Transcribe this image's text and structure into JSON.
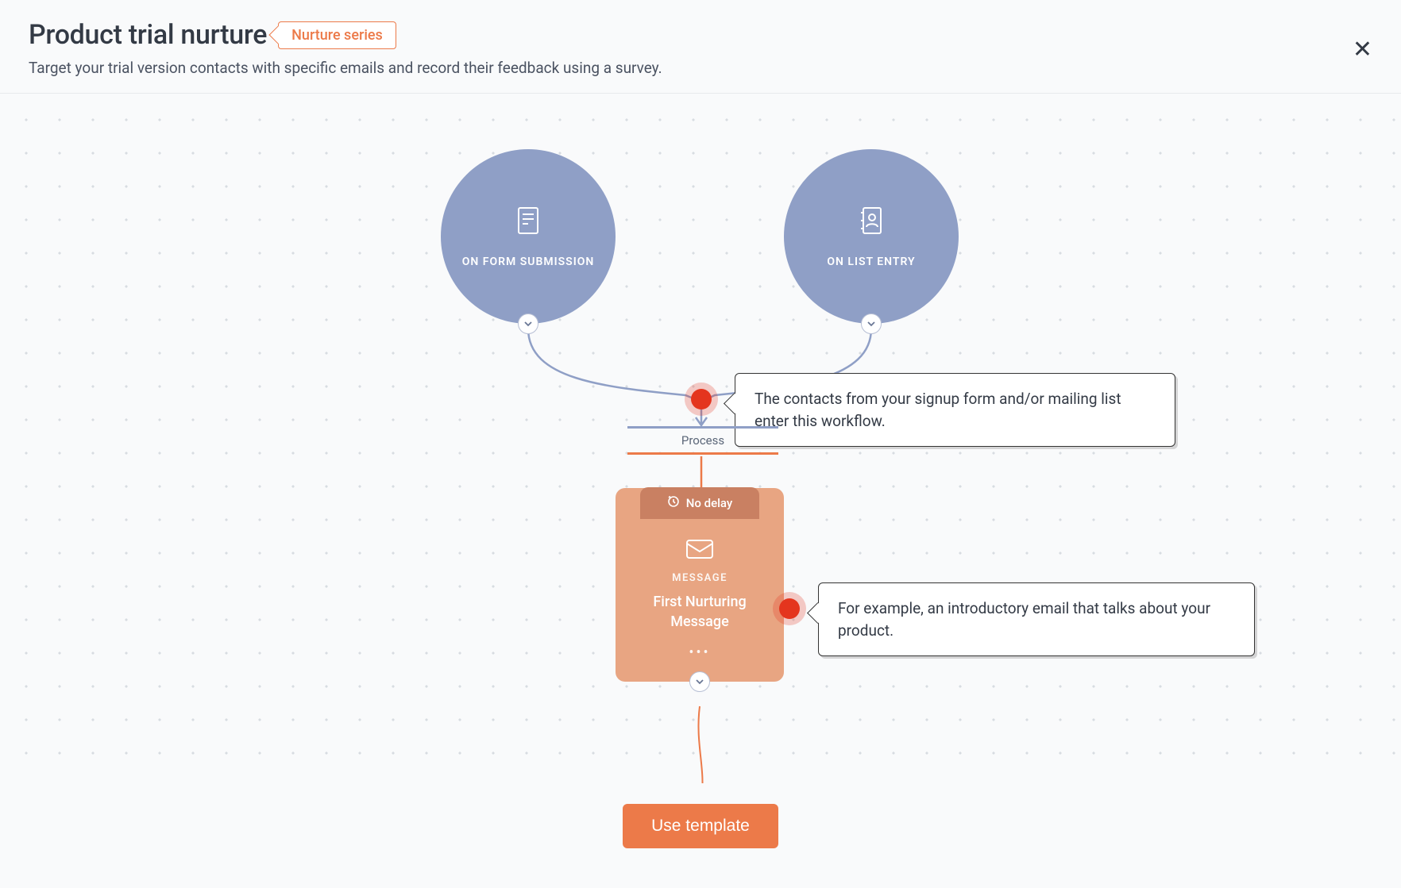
{
  "header": {
    "title": "Product trial nurture",
    "tag": "Nurture series",
    "subtitle": "Target your trial version contacts with specific emails and record their feedback using a survey."
  },
  "triggers": {
    "form": {
      "label": "ON FORM SUBMISSION"
    },
    "list": {
      "label": "ON LIST ENTRY"
    }
  },
  "process_label": "Process",
  "message": {
    "delay": "No delay",
    "type": "MESSAGE",
    "name": "First Nurturing Message"
  },
  "callouts": {
    "entry": "The contacts from your signup form and/or mailing list enter this workflow.",
    "message": "For example, an introductory email that talks about your product."
  },
  "footer": {
    "button": "Use template"
  }
}
